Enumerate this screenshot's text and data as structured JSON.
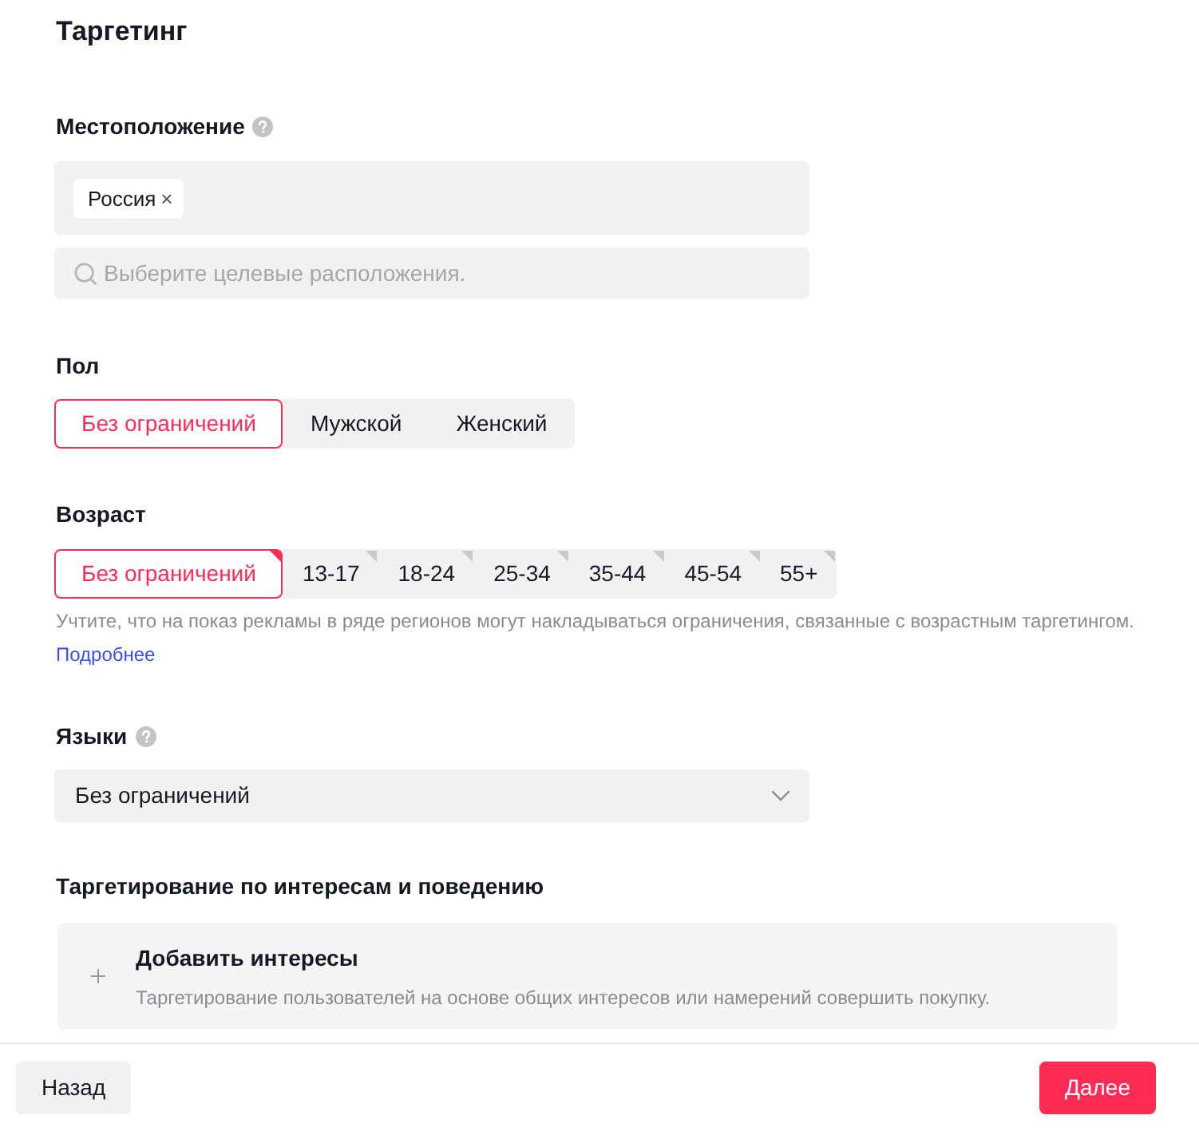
{
  "title": "Таргетинг",
  "location": {
    "label": "Местоположение",
    "help": true,
    "tags": [
      {
        "label": "Россия",
        "remove": "×"
      }
    ],
    "search": {
      "placeholder": "Выберите целевые расположения."
    }
  },
  "gender": {
    "label": "Пол",
    "options": [
      {
        "label": "Без ограничений",
        "selected": true
      },
      {
        "label": "Мужской",
        "selected": false
      },
      {
        "label": "Женский",
        "selected": false
      }
    ]
  },
  "age": {
    "label": "Возраст",
    "options": [
      {
        "label": "Без ограничений",
        "selected": true
      },
      {
        "label": "13-17",
        "selected": false
      },
      {
        "label": "18-24",
        "selected": false
      },
      {
        "label": "25-34",
        "selected": false
      },
      {
        "label": "35-44",
        "selected": false
      },
      {
        "label": "45-54",
        "selected": false
      },
      {
        "label": "55+",
        "selected": false
      }
    ],
    "note": "Учтите, что на показ рекламы в ряде регионов могут накладываться ограничения, связанные с возрастным таргетингом.",
    "link": "Подробнее"
  },
  "languages": {
    "label": "Языки",
    "help": true,
    "select": {
      "value": "Без ограничений"
    }
  },
  "interests": {
    "label": "Таргетирование по интересам и поведению",
    "card": {
      "title": "Добавить интересы",
      "description": "Таргетирование пользователей на основе общих интересов или намерений совершить покупку."
    }
  },
  "footer": {
    "buttons": [
      {
        "label": "Назад",
        "kind": "secondary"
      },
      {
        "label": "Далее",
        "kind": "primary"
      }
    ]
  }
}
